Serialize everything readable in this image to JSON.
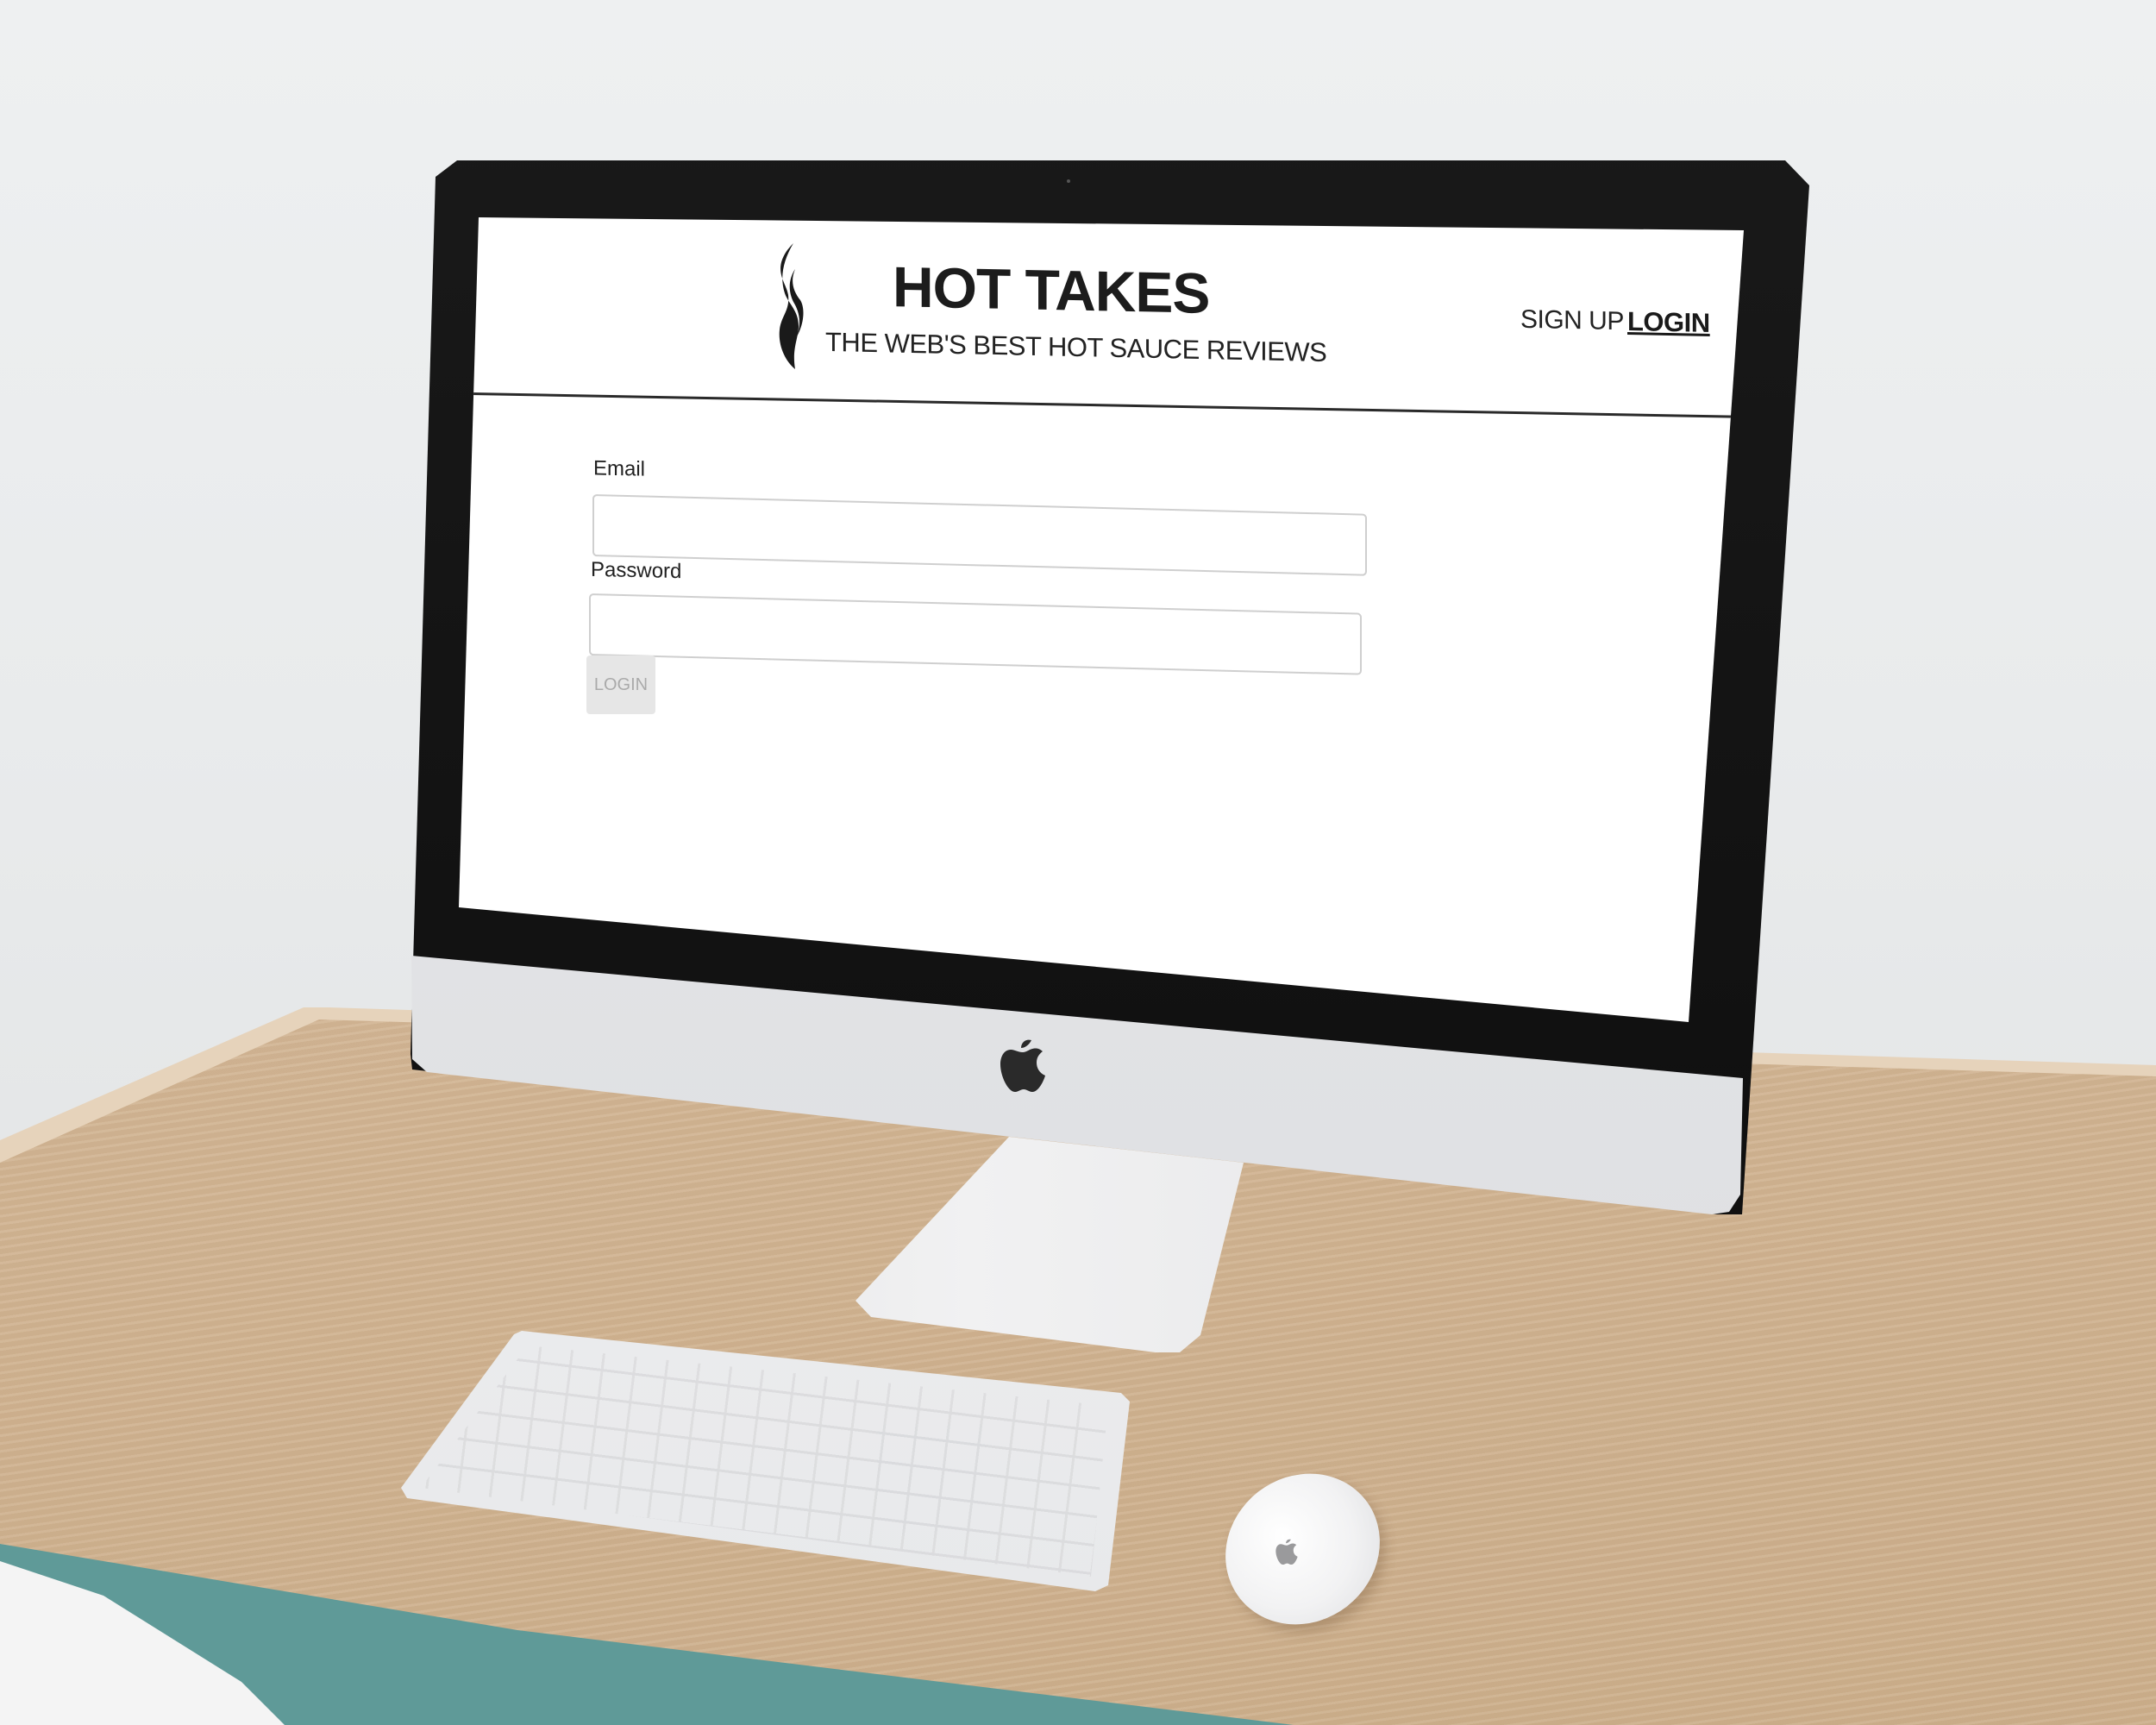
{
  "site": {
    "title": "HOT TAKES",
    "tagline": "THE WEB'S BEST HOT SAUCE REVIEWS",
    "logo_icon": "flame-icon"
  },
  "nav": {
    "signup_label": "SIGN UP",
    "login_label": "LOGIN"
  },
  "form": {
    "email_label": "Email",
    "email_value": "",
    "password_label": "Password",
    "password_value": "",
    "submit_label": "LOGIN"
  },
  "colors": {
    "screen_background": "#ffffff",
    "text": "#222222",
    "button_disabled": "#e6e6e6",
    "desk": "#d4b898",
    "wall": "#eceeef"
  }
}
